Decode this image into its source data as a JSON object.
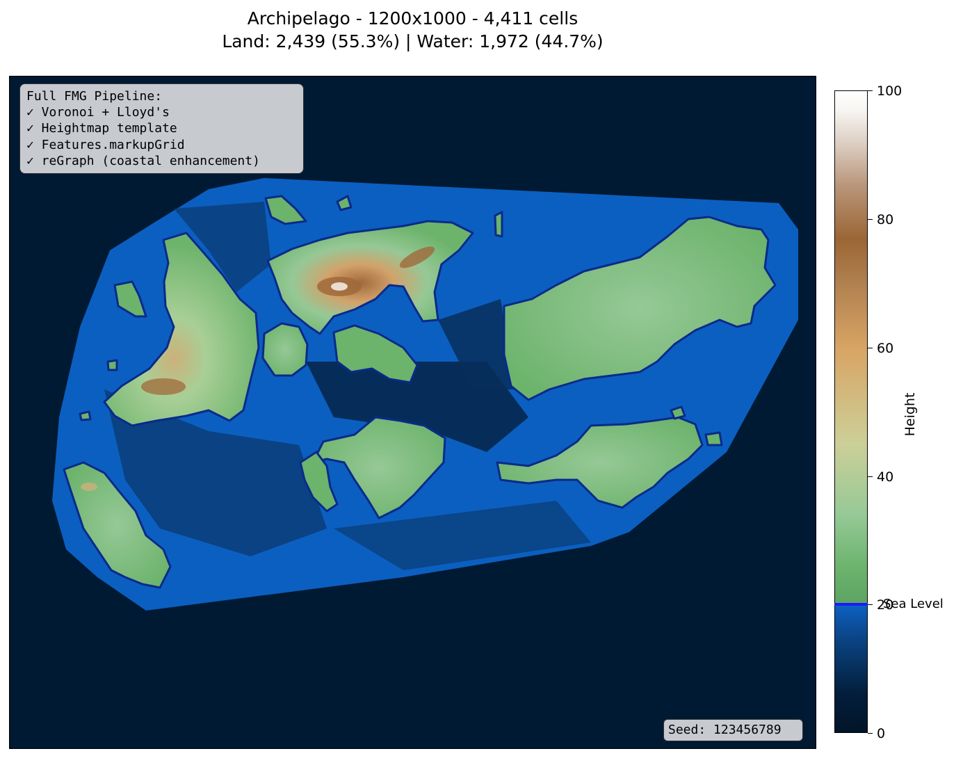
{
  "title": {
    "line1": "Archipelago - 1200x1000 - 4,411 cells",
    "line2": "Land: 2,439 (55.3%) | Water: 1,972 (44.7%)"
  },
  "info_box": {
    "lines": [
      "Full FMG Pipeline:",
      "✓ Voronoi + Lloyd's",
      "✓ Heightmap template",
      "✓ Features.markupGrid",
      "✓ reGraph (coastal enhancement)"
    ]
  },
  "seed_label": "Seed: 123456789",
  "colorbar": {
    "label": "Height",
    "min": 0,
    "max": 100,
    "ticks": [
      "0",
      "20",
      "40",
      "60",
      "80",
      "100"
    ],
    "sea_level": 20,
    "sea_level_label": "Sea Level",
    "sea_level_color": "#1a1aff"
  },
  "colors": {
    "deep_ocean": "#001a33",
    "shelf": "#0b5fc0",
    "shelf_dark": "#0a3d78",
    "land_low": "#6cb36c",
    "land_mid": "#96c896",
    "land_high": "#cdb07a",
    "peak": "#a0693b",
    "coastline": "#0a2a8a"
  }
}
